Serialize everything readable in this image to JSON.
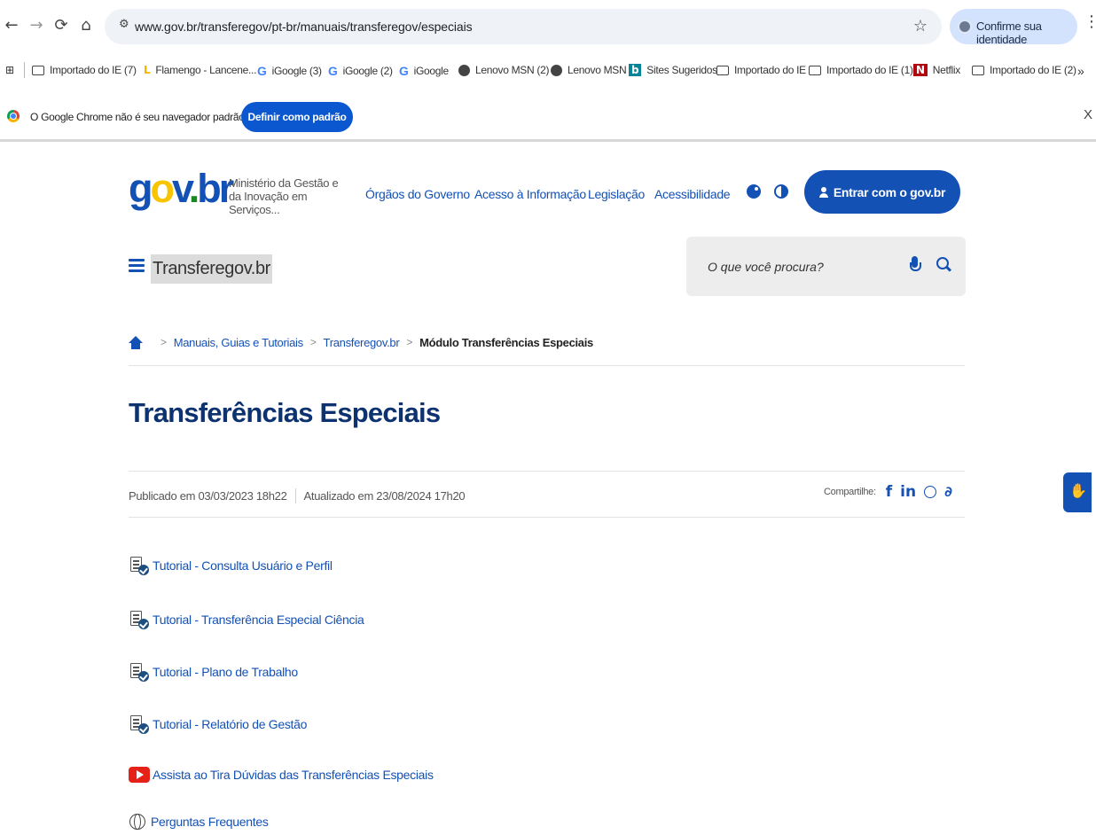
{
  "browser": {
    "url": "www.gov.br/transferegov/pt-br/manuais/transferegov/especiais",
    "identity_label": "Confirme sua identidade",
    "bookmarks": [
      {
        "icon": "folder-icon",
        "label": "Importado do IE (7)"
      },
      {
        "icon": "lance-icon",
        "label": "Flamengo - Lancene..."
      },
      {
        "icon": "google-icon",
        "label": "iGoogle (3)"
      },
      {
        "icon": "google-icon",
        "label": "iGoogle (2)"
      },
      {
        "icon": "google-icon",
        "label": "iGoogle"
      },
      {
        "icon": "globe-icon",
        "label": "Lenovo MSN (2)"
      },
      {
        "icon": "globe-icon",
        "label": "Lenovo MSN"
      },
      {
        "icon": "bing-icon",
        "label": "Sites Sugeridos"
      },
      {
        "icon": "folder-icon",
        "label": "Importado do IE"
      },
      {
        "icon": "folder-icon",
        "label": "Importado do IE (1)"
      },
      {
        "icon": "netflix-icon",
        "label": "Netflix"
      },
      {
        "icon": "folder-icon",
        "label": "Importado do IE (2)"
      }
    ],
    "overflow": "»",
    "infobar": {
      "message": "O Google Chrome não é seu navegador padrão",
      "button": "Definir como padrão",
      "close": "X"
    }
  },
  "header": {
    "ministry": "Ministério da Gestão e da Inovação em Serviços...",
    "links": [
      "Órgãos do Governo",
      "Acesso à Informação",
      "Legislação",
      "Acessibilidade"
    ],
    "login_label": "Entrar com o gov.br",
    "site_name": "Transferegov.br",
    "search_placeholder": "O que você procura?"
  },
  "breadcrumb": {
    "links": [
      "Manuais, Guias e Tutoriais",
      "Transferegov.br"
    ],
    "current": "Módulo Transferências Especiais",
    "separator": ">"
  },
  "page": {
    "title": "Transferências Especiais",
    "published": "Publicado em 03/03/2023 18h22",
    "updated": "Atualizado em 23/08/2024 17h20",
    "share_label": "Compartilhe:",
    "items": [
      {
        "icon": "document-check-icon",
        "label": "Tutorial - Consulta Usuário e Perfil"
      },
      {
        "icon": "document-check-icon",
        "label": "Tutorial - Transferência Especial Ciência"
      },
      {
        "icon": "document-check-icon",
        "label": "Tutorial - Plano de Trabalho"
      },
      {
        "icon": "document-check-icon",
        "label": "Tutorial - Relatório de Gestão"
      },
      {
        "icon": "youtube-icon",
        "label": "Assista ao Tira Dúvidas das Transferências Especiais"
      },
      {
        "icon": "globe-icon",
        "label": "Perguntas Frequentes"
      }
    ]
  },
  "colors": {
    "primary": "#1351b4",
    "title": "#0c326f",
    "chrome_blue": "#0b57d0"
  }
}
